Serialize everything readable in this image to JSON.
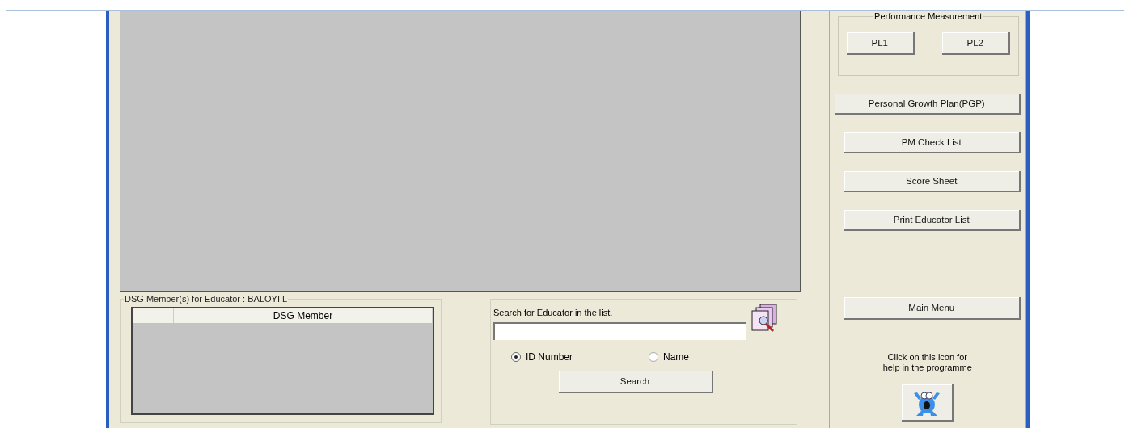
{
  "dsg_group": {
    "title": "DSG Member(s) for Educator : BALOYI L",
    "table": {
      "columns": [
        "",
        "DSG Member"
      ]
    }
  },
  "search_group": {
    "label": "Search for Educator in the list.",
    "options": [
      {
        "label": "ID Number",
        "selected": true
      },
      {
        "label": "Name",
        "selected": false
      }
    ],
    "button": "Search"
  },
  "performance_group": {
    "title": "Performance Measurement",
    "buttons": [
      "PL1",
      "PL2"
    ]
  },
  "side_buttons": [
    "Personal Growth Plan(PGP)",
    "PM Check List",
    "Score Sheet",
    "Print Educator List"
  ],
  "main_menu_button": "Main Menu",
  "help_text": "Click on this icon for\nhelp in the programme"
}
